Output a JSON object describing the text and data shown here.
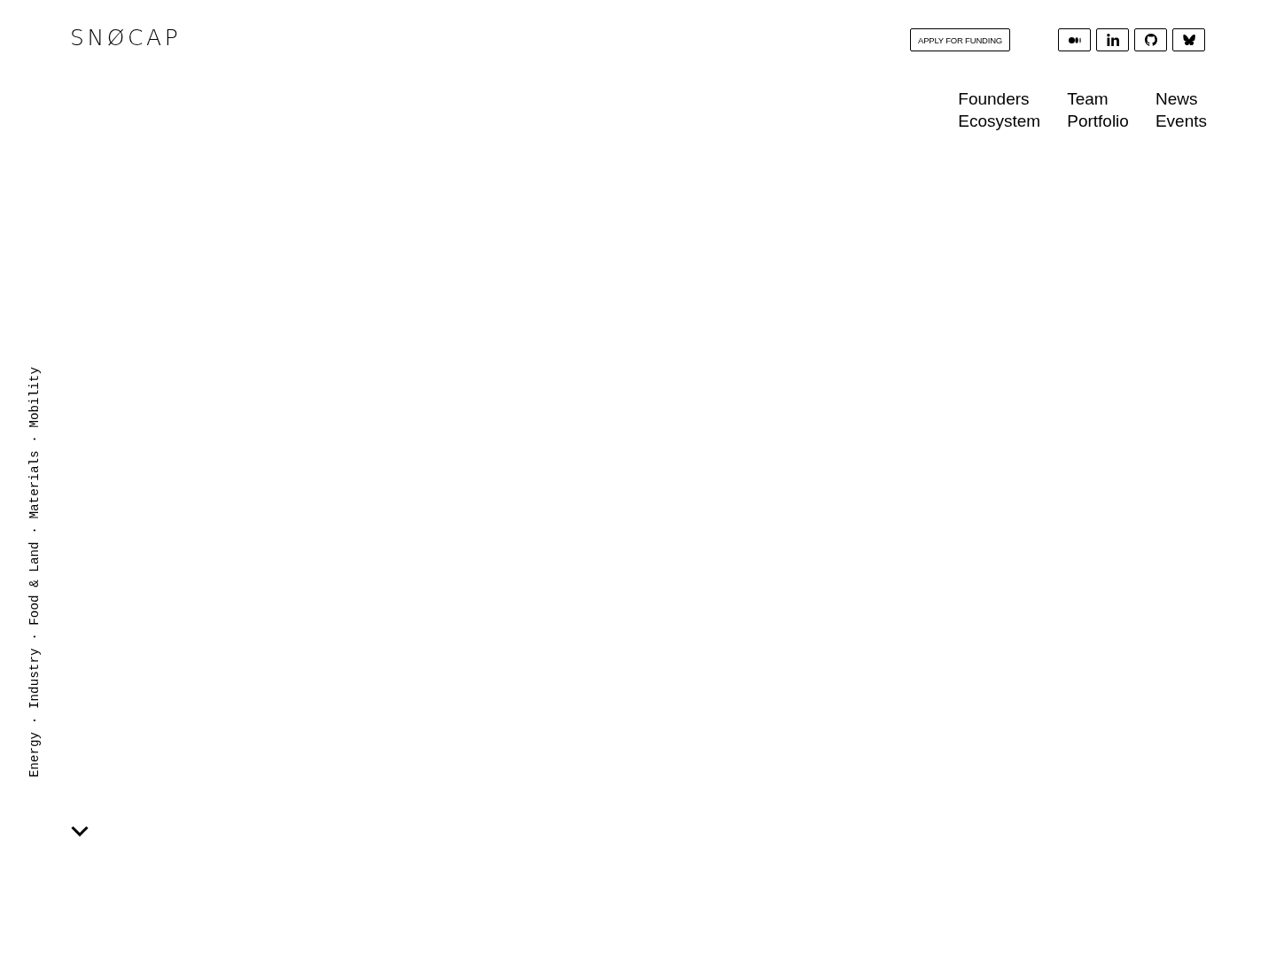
{
  "header": {
    "logo": "SNØCAP",
    "apply_button": "APPLY FOR FUNDING",
    "social_links": [
      {
        "kind": "medium"
      },
      {
        "kind": "linkedin"
      },
      {
        "kind": "github"
      },
      {
        "kind": "bluesky"
      }
    ]
  },
  "nav": {
    "columns": [
      [
        "Founders",
        "Ecosystem"
      ],
      [
        "Team",
        "Portfolio"
      ],
      [
        "News",
        "Events"
      ]
    ]
  },
  "sectors_text": "Energy · Industry · Food & Land · Materials · Mobility"
}
